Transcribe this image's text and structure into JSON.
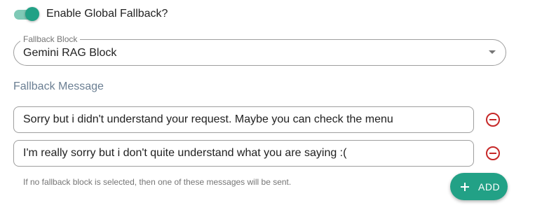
{
  "global_fallback": {
    "enabled": true,
    "toggle_label": "Enable Global Fallback?"
  },
  "fallback_block": {
    "label": "Fallback Block",
    "selected_value": "Gemini RAG Block"
  },
  "fallback_messages": {
    "title": "Fallback Message",
    "items": [
      {
        "value": "Sorry but i didn't understand your request. Maybe you can check the menu"
      },
      {
        "value": "I'm really sorry but i don't quite understand what you are saying :("
      }
    ],
    "hint": "If no fallback block is selected, then one of these messages will be sent.",
    "add_label": "ADD"
  },
  "colors": {
    "accent": "#22a186",
    "toggle_track": "#7fc9b6",
    "remove_icon": "#c62828",
    "section_title": "#6b7f93"
  },
  "icons": {
    "remove": "minus-circle-icon",
    "add": "plus-icon",
    "select": "caret-down-icon"
  }
}
